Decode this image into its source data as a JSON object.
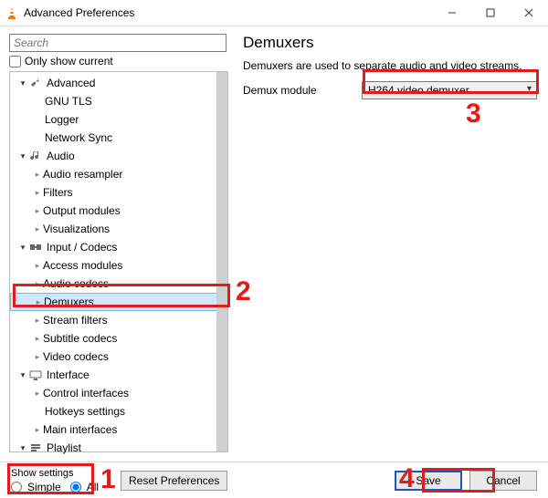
{
  "window": {
    "title": "Advanced Preferences"
  },
  "search": {
    "placeholder": "Search"
  },
  "only_show_current": {
    "label": "Only show current"
  },
  "tree": {
    "advanced": {
      "label": "Advanced"
    },
    "gnu_tls": {
      "label": "GNU TLS"
    },
    "logger": {
      "label": "Logger"
    },
    "network_sync": {
      "label": "Network Sync"
    },
    "audio": {
      "label": "Audio"
    },
    "audio_resampler": {
      "label": "Audio resampler"
    },
    "filters": {
      "label": "Filters"
    },
    "output_modules": {
      "label": "Output modules"
    },
    "visualizations": {
      "label": "Visualizations"
    },
    "input_codecs": {
      "label": "Input / Codecs"
    },
    "access_modules": {
      "label": "Access modules"
    },
    "audio_codecs": {
      "label": "Audio codecs"
    },
    "demuxers": {
      "label": "Demuxers"
    },
    "stream_filters": {
      "label": "Stream filters"
    },
    "subtitle_codecs": {
      "label": "Subtitle codecs"
    },
    "video_codecs": {
      "label": "Video codecs"
    },
    "interface": {
      "label": "Interface"
    },
    "control_ifaces": {
      "label": "Control interfaces"
    },
    "hotkeys": {
      "label": "Hotkeys settings"
    },
    "main_ifaces": {
      "label": "Main interfaces"
    },
    "playlist": {
      "label": "Playlist"
    }
  },
  "right": {
    "title": "Demuxers",
    "desc": "Demuxers are used to separate audio and video streams.",
    "setting_label": "Demux module",
    "combo_value": "H264 video demuxer"
  },
  "footer": {
    "show_settings": "Show settings",
    "simple": "Simple",
    "all": "All",
    "reset": "Reset Preferences",
    "save": "Save",
    "cancel": "Cancel"
  },
  "callouts": {
    "n1": "1",
    "n2": "2",
    "n3": "3",
    "n4": "4"
  }
}
